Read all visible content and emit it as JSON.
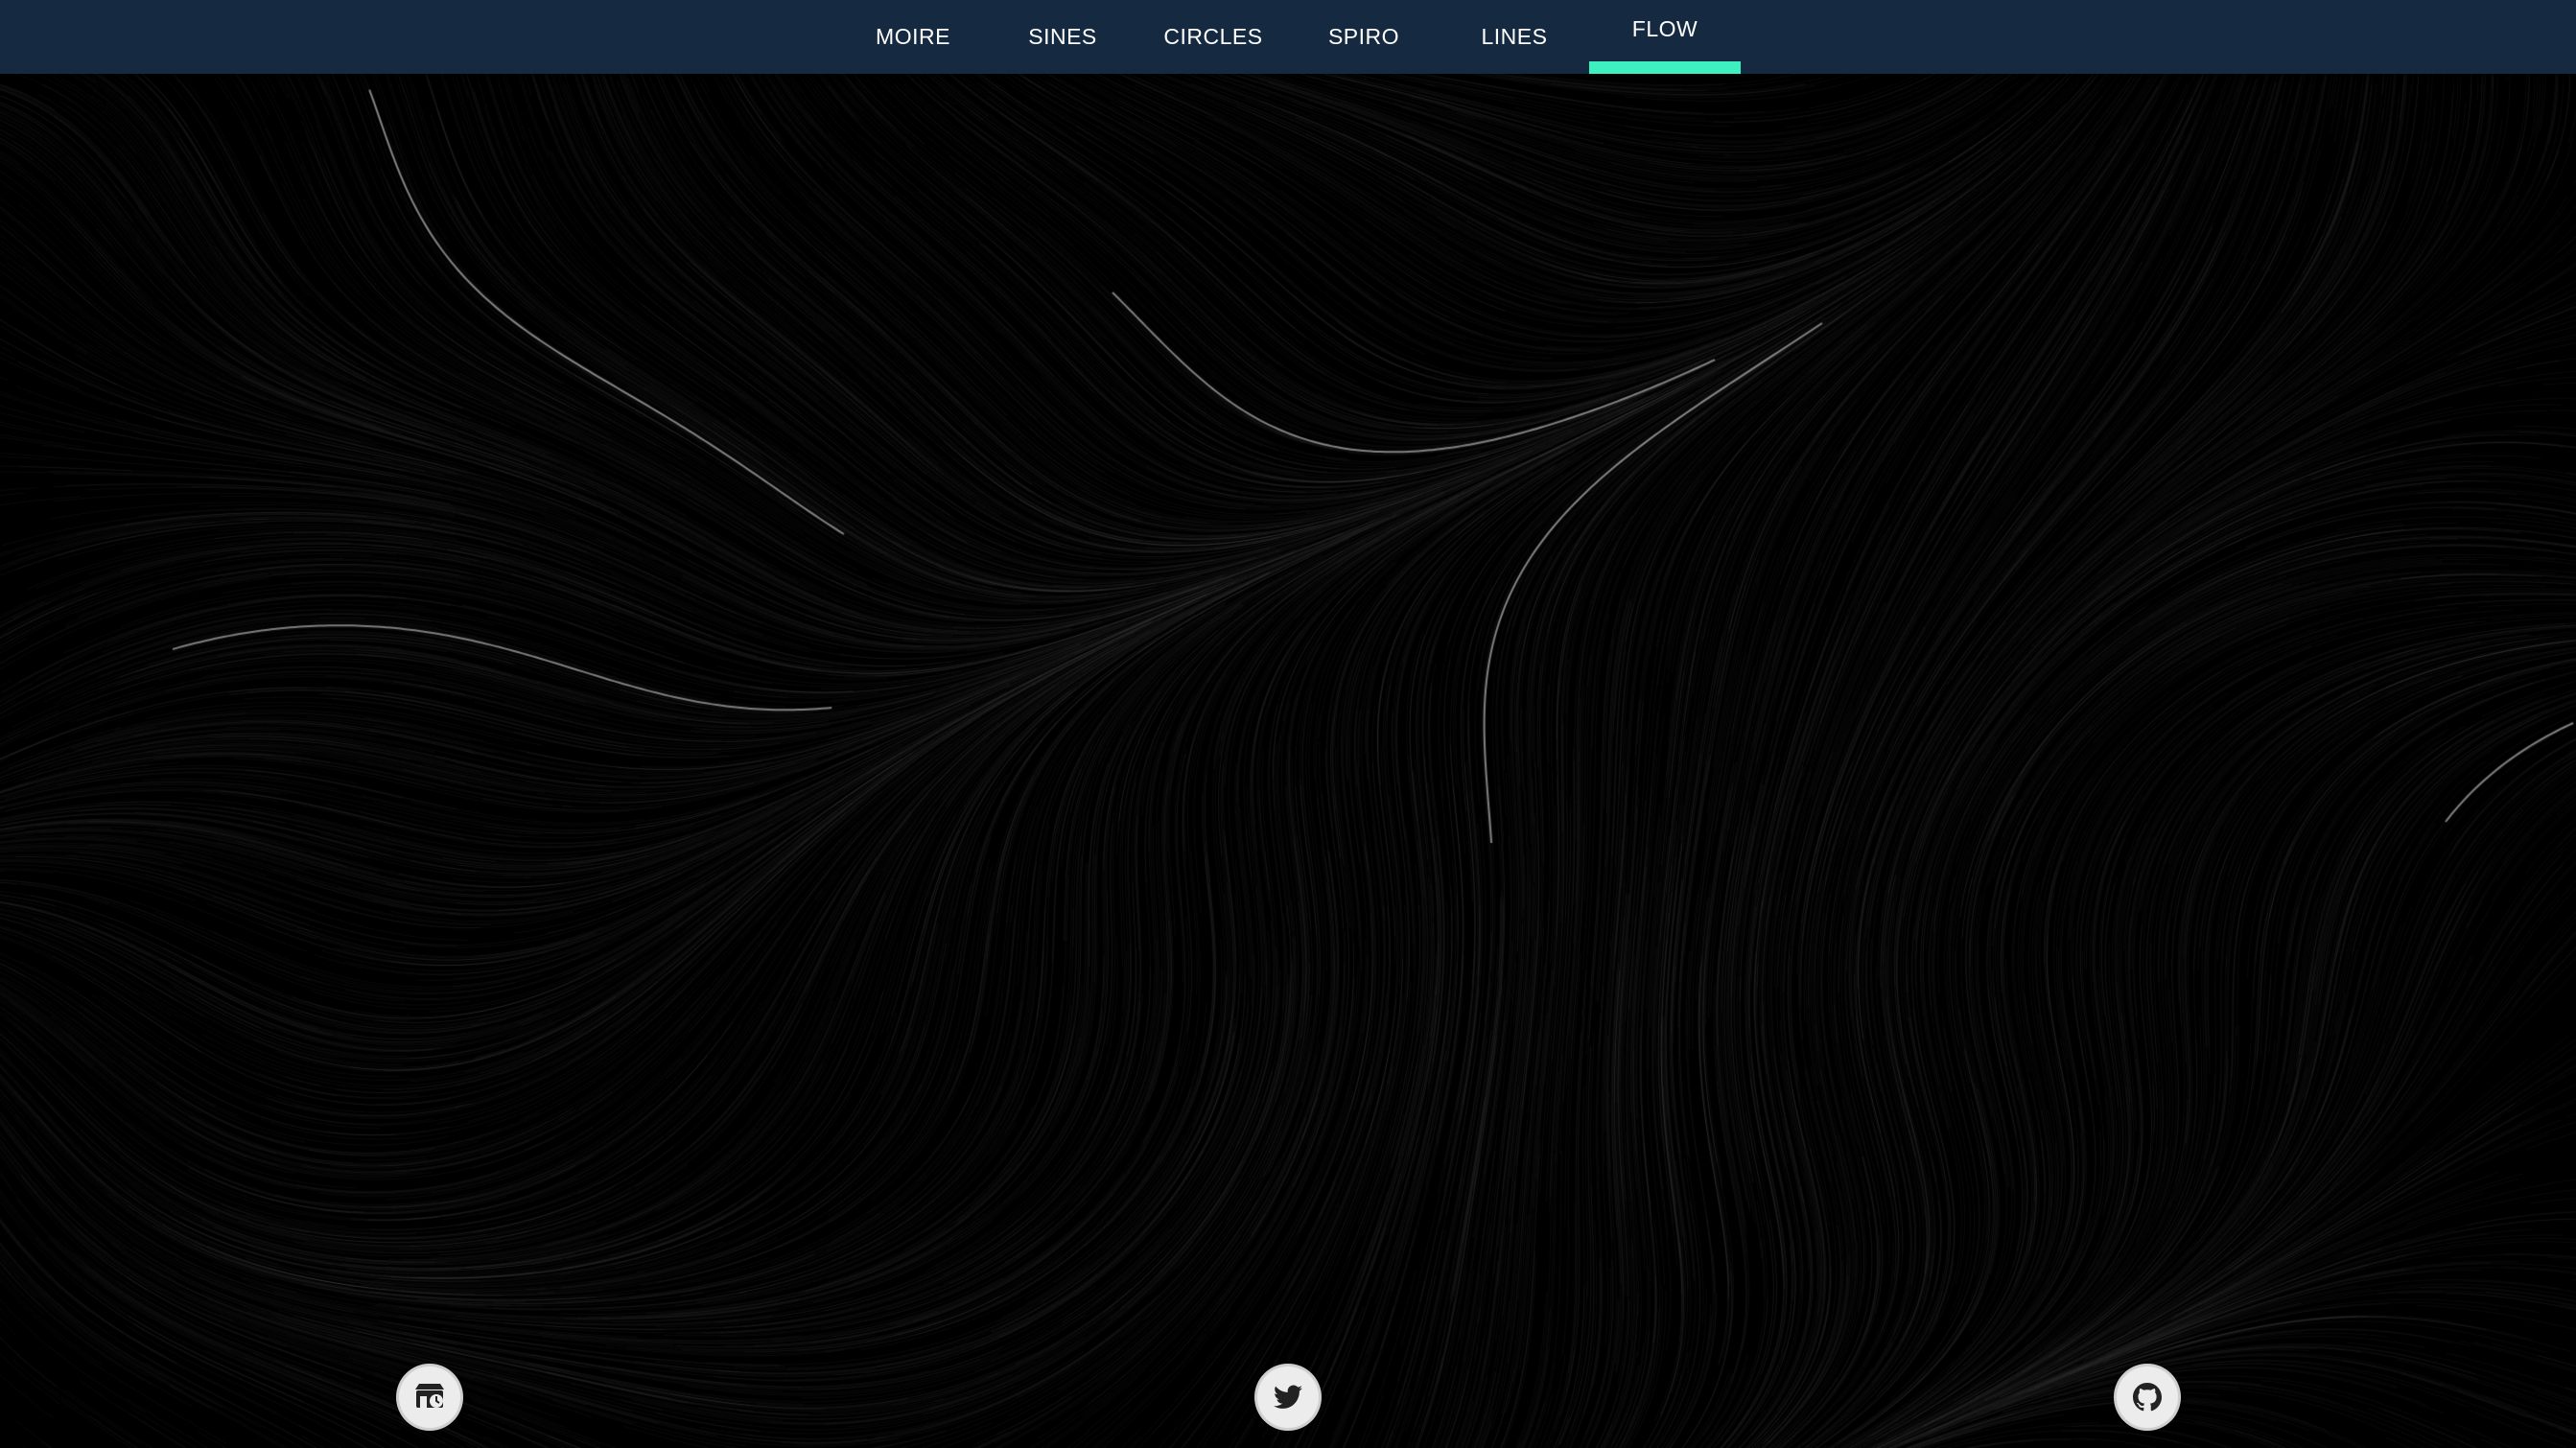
{
  "nav": {
    "tabs": [
      {
        "label": "MOIRE",
        "active": false
      },
      {
        "label": "SINES",
        "active": false
      },
      {
        "label": "CIRCLES",
        "active": false
      },
      {
        "label": "SPIRO",
        "active": false
      },
      {
        "label": "LINES",
        "active": false
      },
      {
        "label": "FLOW",
        "active": true
      }
    ],
    "accent_color": "#3ef0c0",
    "bar_color": "#152a41"
  },
  "canvas": {
    "background": "#000000",
    "stroke_color": "#ffffff",
    "style": "flow-field"
  },
  "footer": {
    "links": [
      {
        "icon": "shop-icon"
      },
      {
        "icon": "twitter-icon"
      },
      {
        "icon": "github-icon"
      }
    ]
  }
}
